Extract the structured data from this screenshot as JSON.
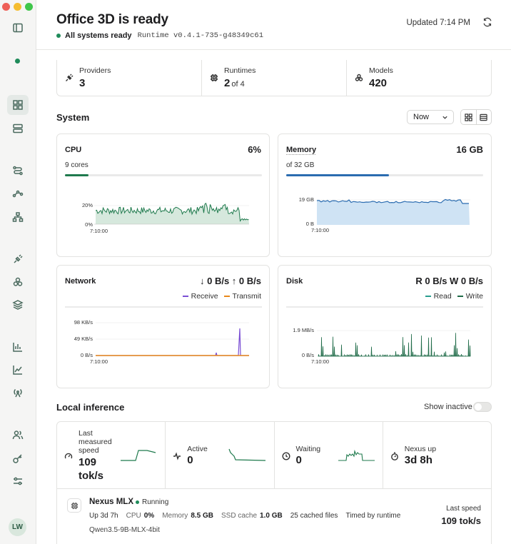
{
  "colors": {
    "accent": "#1f7a4d",
    "memory": "#2b6cb0",
    "memory_fill": "#cfe3f4",
    "receive": "#7b4fd4",
    "transmit": "#e8891a",
    "status_green": "#1f8b5a"
  },
  "header": {
    "title": "Office 3D is ready",
    "status": "All systems ready",
    "runtime": "Runtime v0.4.1-735-g48349c61",
    "updated": "Updated 7:14 PM"
  },
  "summary": [
    {
      "label": "Providers",
      "value": "3",
      "sub": "",
      "icon": "plug-icon"
    },
    {
      "label": "Runtimes",
      "value": "2",
      "sub": "of 4",
      "icon": "chip-icon"
    },
    {
      "label": "Models",
      "value": "420",
      "sub": "",
      "icon": "cubes-icon"
    }
  ],
  "system": {
    "title": "System",
    "range": "Now",
    "cpu": {
      "title": "CPU",
      "value": "6%",
      "sub": "9 cores",
      "usage_fraction": 0.06,
      "y_ticks": [
        "20%",
        "0%"
      ],
      "x_start": "7:10:00"
    },
    "memory": {
      "title": "Memory",
      "value": "16 GB",
      "sub": "of 32 GB",
      "usage_fraction": 0.5,
      "y_ticks": [
        "19 GB",
        "0 B"
      ],
      "x_start": "7:10:00"
    },
    "network": {
      "title": "Network",
      "value": "↓ 0 B/s ↑ 0 B/s",
      "legend": [
        "Receive",
        "Transmit"
      ],
      "y_ticks": [
        "98 KB/s",
        "49 KB/s",
        "0 B/s"
      ],
      "x_start": "7:10:00"
    },
    "disk": {
      "title": "Disk",
      "value": "R 0 B/s W 0 B/s",
      "legend": [
        "Read",
        "Write"
      ],
      "y_ticks": [
        "1.9 MB/s",
        "0 B/s"
      ],
      "x_start": "7:10:00"
    }
  },
  "inference": {
    "title": "Local inference",
    "show_inactive": "Show inactive",
    "stats": [
      {
        "label": "Last measured speed",
        "value": "109 tok/s",
        "icon": "gauge-icon"
      },
      {
        "label": "Active",
        "value": "0",
        "icon": "pulse-icon"
      },
      {
        "label": "Waiting",
        "value": "0",
        "icon": "clock-icon"
      },
      {
        "label": "Nexus up",
        "value": "3d 8h",
        "icon": "stopwatch-icon"
      }
    ],
    "runtime": {
      "name": "Nexus MLX",
      "status": "Running",
      "uptime_label": "Up",
      "uptime": "3d 7h",
      "cpu_label": "CPU",
      "cpu": "0%",
      "memory_label": "Memory",
      "memory": "8.5 GB",
      "ssd_label": "SSD cache",
      "ssd": "1.0 GB",
      "cached": "25 cached files",
      "timed": "Timed by runtime",
      "model": "Qwen3.5-9B-MLX-4bit",
      "speed_label": "Last speed",
      "speed": "109 tok/s"
    }
  },
  "user": {
    "initials": "LW"
  }
}
